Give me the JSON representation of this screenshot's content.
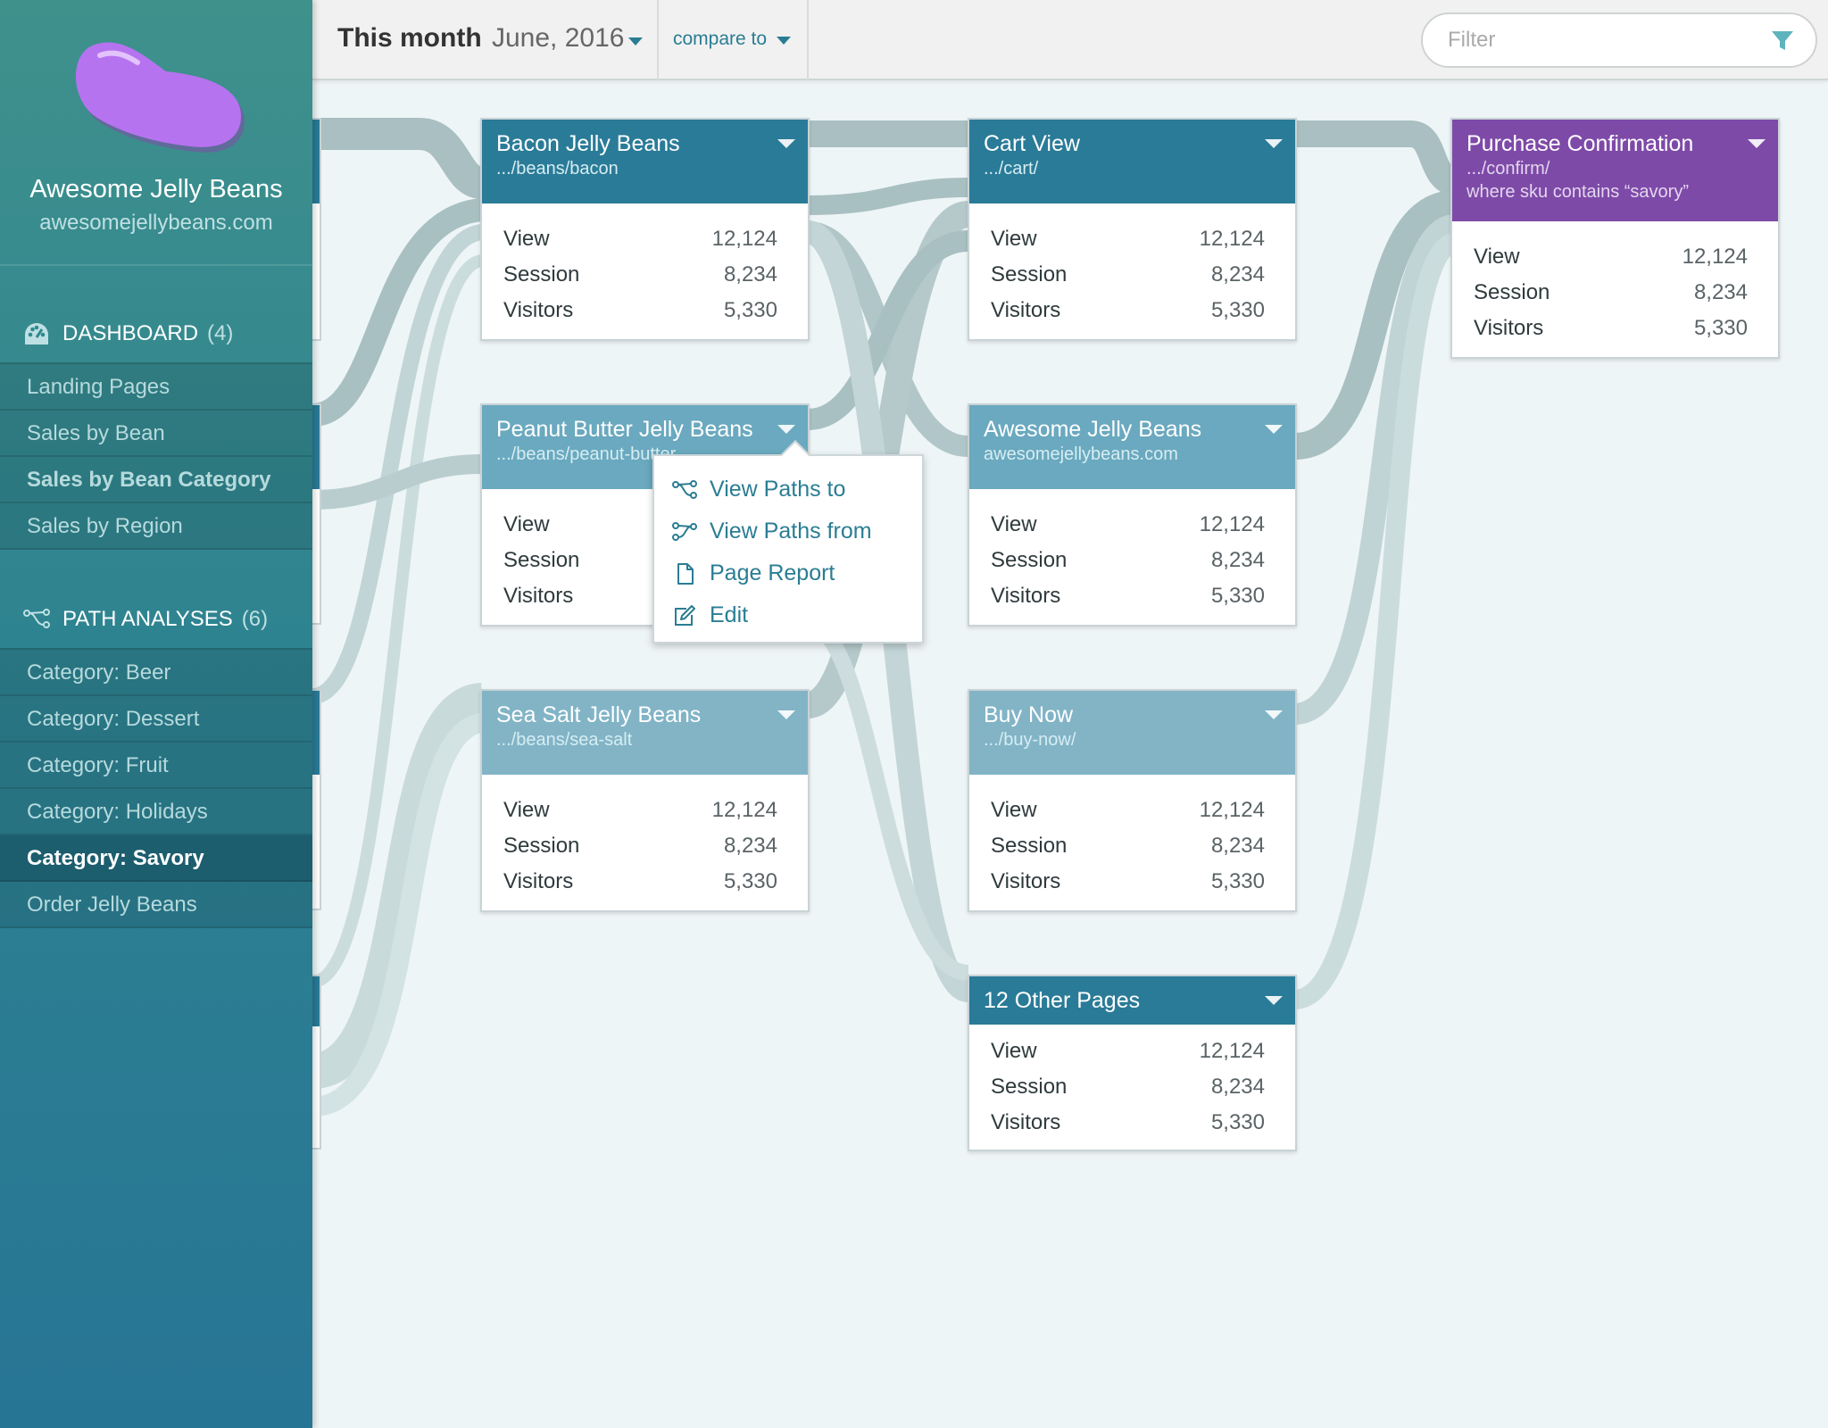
{
  "app": {
    "name": "Awesome Jelly Beans",
    "url": "awesomejellybeans.com"
  },
  "sidebar": {
    "dashboard": {
      "label": "DASHBOARD",
      "count": "(4)",
      "items": [
        {
          "label": "Landing Pages"
        },
        {
          "label": "Sales by Bean"
        },
        {
          "label": "Sales by Bean Category"
        },
        {
          "label": "Sales by Region"
        }
      ]
    },
    "paths": {
      "label": "PATH ANALYSES",
      "count": "(6)",
      "items": [
        {
          "label": "Category: Beer"
        },
        {
          "label": "Category: Dessert"
        },
        {
          "label": "Category: Fruit"
        },
        {
          "label": "Category: Holidays"
        },
        {
          "label": "Category: Savory"
        },
        {
          "label": "Order Jelly Beans"
        }
      ]
    }
  },
  "topbar": {
    "period_label": "This month",
    "period_value": "June, 2016",
    "compare_label": "compare to",
    "filter_placeholder": "Filter"
  },
  "metric_labels": {
    "view": "View",
    "session": "Session",
    "visitors": "Visitors"
  },
  "cards": {
    "bacon": {
      "title": "Bacon Jelly Beans",
      "subtitle": ".../beans/bacon",
      "view": "12,124",
      "session": "8,234",
      "visitors": "5,330"
    },
    "peanut": {
      "title": "Peanut Butter Jelly Beans",
      "subtitle": ".../beans/peanut-butter"
    },
    "seasalt": {
      "title": "Sea Salt Jelly Beans",
      "subtitle": ".../beans/sea-salt",
      "view": "12,124",
      "session": "8,234",
      "visitors": "5,330"
    },
    "cart": {
      "title": "Cart View",
      "subtitle": ".../cart/",
      "view": "12,124",
      "session": "8,234",
      "visitors": "5,330"
    },
    "home": {
      "title": "Awesome Jelly Beans",
      "subtitle": "awesomejellybeans.com",
      "view": "12,124",
      "session": "8,234",
      "visitors": "5,330"
    },
    "buynow": {
      "title": "Buy Now",
      "subtitle": ".../buy-now/",
      "view": "12,124",
      "session": "8,234",
      "visitors": "5,330"
    },
    "other": {
      "title": "12 Other Pages",
      "view": "12,124",
      "session": "8,234",
      "visitors": "5,330"
    },
    "purchase": {
      "title": "Purchase Confirmation",
      "subtitle": ".../confirm/",
      "subtitle2": "where sku contains “savory”",
      "view": "12,124",
      "session": "8,234",
      "visitors": "5,330"
    }
  },
  "context_menu": {
    "items": [
      {
        "label": "View Paths to",
        "icon": "paths-to-icon"
      },
      {
        "label": "View Paths from",
        "icon": "paths-from-icon"
      },
      {
        "label": "Page Report",
        "icon": "document-icon"
      },
      {
        "label": "Edit",
        "icon": "edit-icon"
      }
    ]
  },
  "colors": {
    "accent": "#2a7d93",
    "card_dark": "#2a7b98",
    "card_light": "#6aa9bf",
    "card_purple": "#7e4aa8",
    "logo": "#b673f0"
  }
}
